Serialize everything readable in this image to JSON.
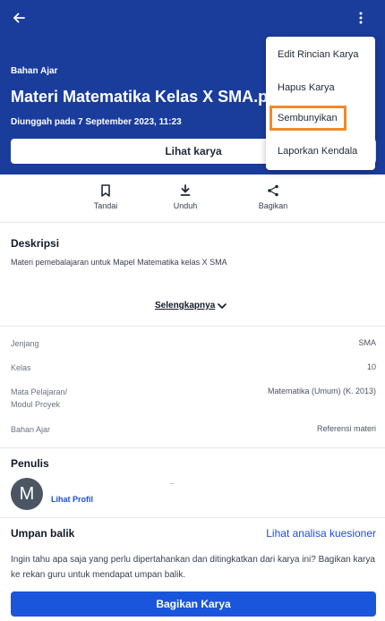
{
  "header": {
    "type_label": "Bahan Ajar",
    "title": "Materi Matematika Kelas X SMA.pdf",
    "upload_date": "Diunggah pada 7 September 2023, 11:23",
    "view_button": "Lihat karya",
    "back_icon": "arrow-left-icon",
    "menu_icon": "more-vertical-icon"
  },
  "menu": {
    "items": [
      {
        "label": "Edit Rincian Karya"
      },
      {
        "label": "Hapus Karya"
      },
      {
        "label": "Sembunyikan"
      },
      {
        "label": "Laporkan Kendala"
      }
    ],
    "highlight_color": "#f08a2a"
  },
  "actions": [
    {
      "label": "Tandai",
      "icon": "bookmark-icon"
    },
    {
      "label": "Unduh",
      "icon": "download-icon"
    },
    {
      "label": "Bagikan",
      "icon": "share-icon"
    }
  ],
  "description": {
    "title": "Deskripsi",
    "text": "Materi pemebalajaran untuk Mapel Matematika kelas X SMA",
    "more_label": "Selengkapnya"
  },
  "meta": [
    {
      "label": "Jenjang",
      "value": "SMA"
    },
    {
      "label": "Kelas",
      "value": "10"
    },
    {
      "label": "Mata Pelajaran/\nModul Proyek",
      "value": "Matematika (Umum) (K. 2013)"
    },
    {
      "label": "Bahan Ajar",
      "value": "Referensi materi"
    }
  ],
  "author": {
    "title": "Penulis",
    "initial": "M",
    "profile_link": "Lihat Profil"
  },
  "feedback": {
    "title": "Umpan balik",
    "link": "Lihat analisa kuesioner",
    "text": "Ingin tahu apa saja yang perlu dipertahankan dan ditingkatkan dari karya ini? Bagikan karya ke rekan guru untuk mendapat umpan balik.",
    "share_button": "Bagikan Karya"
  },
  "colors": {
    "header_bg": "#1a3d9c",
    "primary": "#1a56db",
    "link": "#1d4ed8"
  }
}
